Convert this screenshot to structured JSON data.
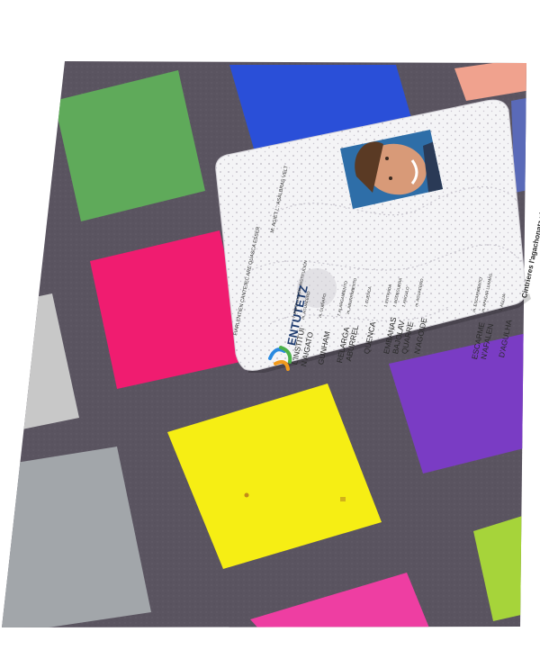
{
  "colors": {
    "page_background": "#ffffff",
    "board": "#5a5460",
    "patch_green": "#5faa5a",
    "patch_blue": "#2a4fd8",
    "patch_salmon": "#f0a28e",
    "patch_magenta": "#f01c70",
    "patch_violet": "#7a3cc4",
    "patch_yellow": "#f6ee14",
    "patch_light_gray": "#c8c8c8",
    "patch_mid_gray": "#a2a6aa",
    "patch_pink": "#ee3ea2",
    "patch_lime": "#a6d43a",
    "patch_slate_blue": "#5a6ab8",
    "card_background": "#f4f4f6",
    "card_pattern": "#a09ca8",
    "card_text": "#2b2b2b",
    "brand_navy": "#1d3a6e",
    "logo_blue": "#2a8ae0",
    "logo_orange": "#f29a1c",
    "logo_green": "#4cb04a",
    "photo_background": "#2e6ea8",
    "photo_skin": "#d89a78",
    "photo_hair": "#5a3a24",
    "photo_shirt": "#2a3a56"
  },
  "card": {
    "brand": "ENTUTETZ",
    "header_line_1": "FIARLENTIEN CANTEJEC ARE QUASCA ESSER",
    "header_line_2": "M: AGIET L': ASALBRAS VELT",
    "footer_phrase": "Cintrieres l'agachonatz n'anden",
    "entries": [
      {
        "word": "L'INSTITUI",
        "gloss": "f. INSTALACIÓN, INSTITUCIÓN"
      },
      {
        "word": "N'AIGATO",
        "gloss": "m. AGUACERO"
      },
      {
        "word": "GUNHAM",
        "gloss": "m. GUIÑAPO"
      },
      {
        "word": "RELARGA",
        "gloss": "f. ALARGAMIENTO"
      },
      {
        "word": "ABURREL",
        "gloss": "m. ABURRIMIENTO"
      },
      {
        "word": "QUENCA",
        "gloss": "f. CUENCA"
      },
      {
        "word": "EMBANAS",
        "gloss": "f. ENTRADA"
      },
      {
        "word": "BAJOLAV",
        "gloss": "f. BODEGUERA"
      },
      {
        "word": "QUARRE",
        "gloss": "f. ANGULO"
      },
      {
        "word": "N'AGOIDE",
        "gloss": "m. AGUACERO"
      },
      {
        "word": "ESCARME",
        "gloss": "m. ESCARMIENTO"
      },
      {
        "word": "N'AFALEN",
        "gloss": "m. APAGAR LLAMAS"
      },
      {
        "word": "D'AGULHA",
        "gloss": "f. AGUJA"
      }
    ]
  }
}
